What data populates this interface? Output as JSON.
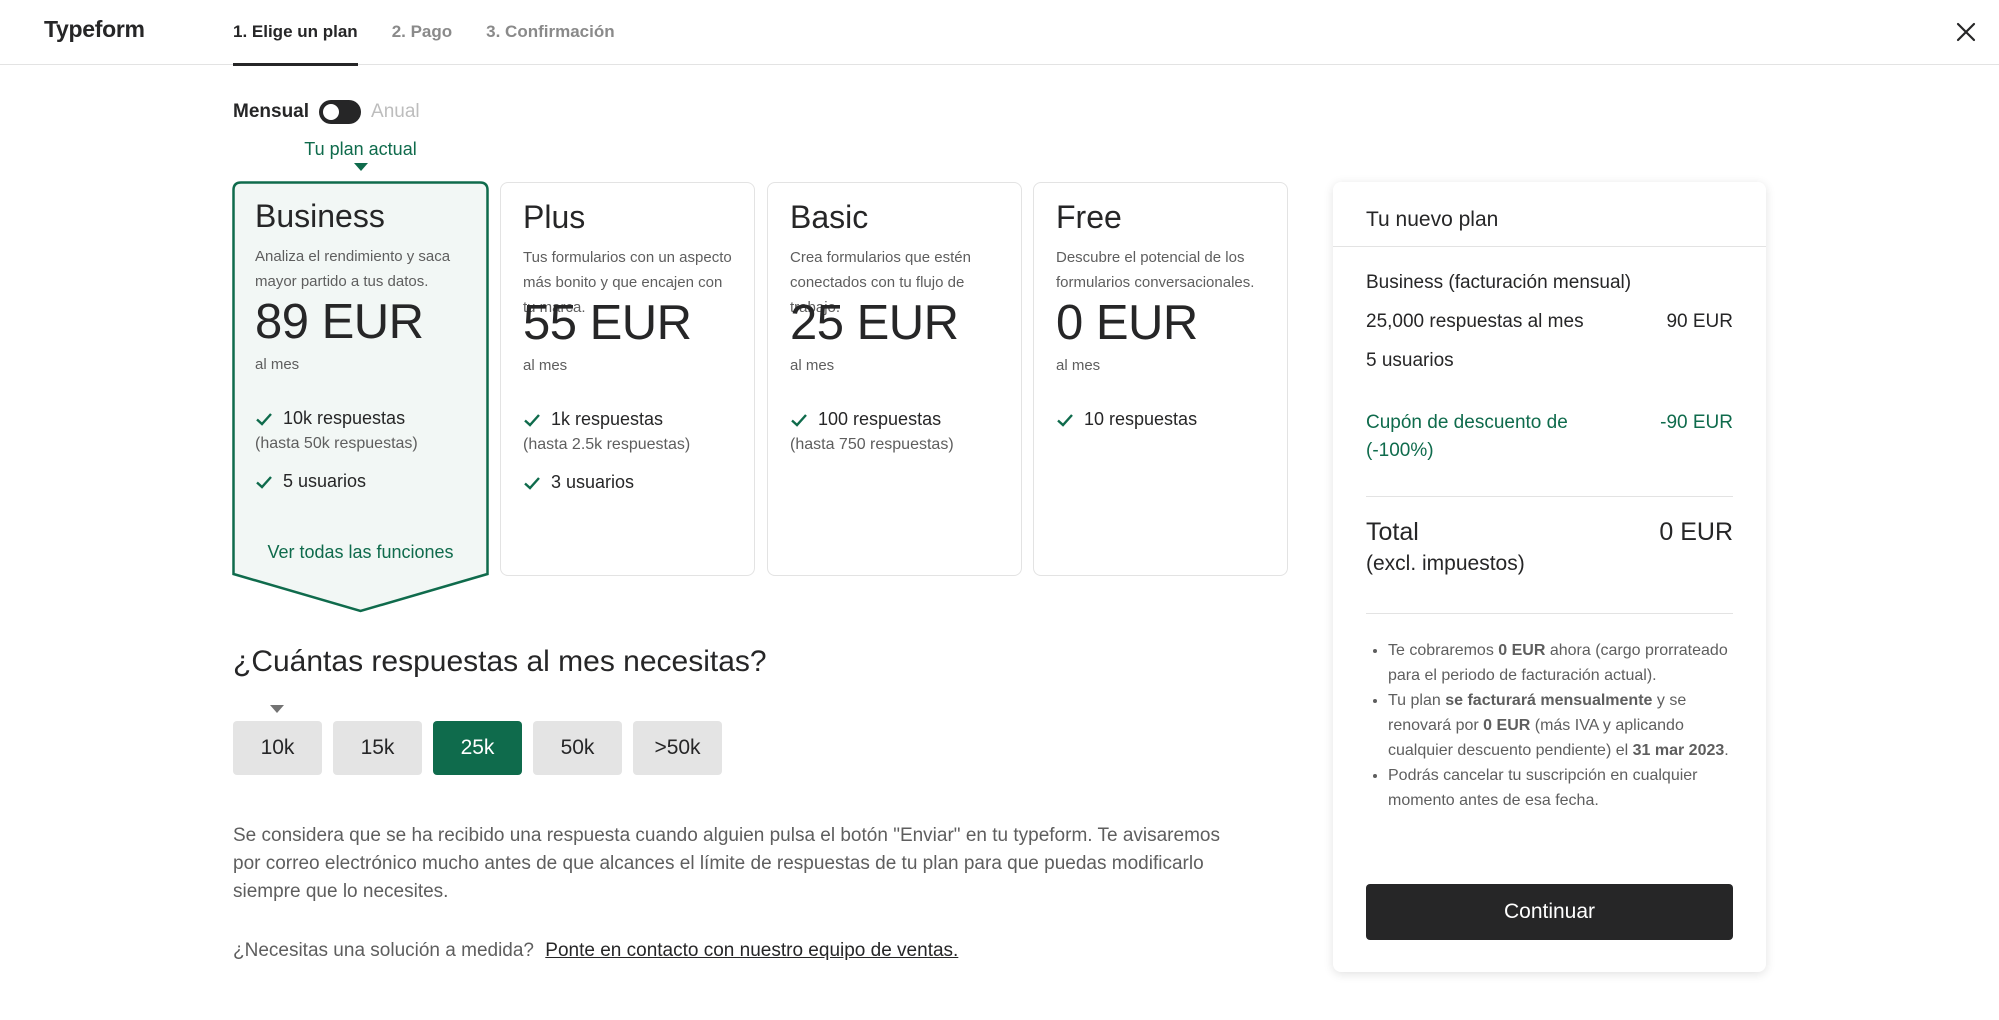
{
  "header": {
    "logo": "Typeform",
    "steps": [
      {
        "label": "1. Elige un plan"
      },
      {
        "label": "2. Pago"
      },
      {
        "label": "3. Confirmación"
      }
    ]
  },
  "billing": {
    "monthly_label": "Mensual",
    "yearly_label": "Anual",
    "current_plan_label": "Tu plan actual"
  },
  "plans": [
    {
      "name": "Business",
      "description": "Analiza el rendimiento y saca mayor partido a tus datos.",
      "price": "89 EUR",
      "period": "al mes",
      "features": [
        {
          "text": "10k respuestas",
          "sub": "(hasta 50k respuestas)"
        },
        {
          "text": "5 usuarios"
        }
      ],
      "see_all": "Ver todas las funciones"
    },
    {
      "name": "Plus",
      "description": "Tus formularios con un aspecto más bonito y que encajen con tu marca.",
      "price": "55 EUR",
      "period": "al mes",
      "features": [
        {
          "text": "1k respuestas",
          "sub": "(hasta 2.5k respuestas)"
        },
        {
          "text": "3 usuarios"
        }
      ]
    },
    {
      "name": "Basic",
      "description": "Crea formularios que estén conectados con tu flujo de trabajo.",
      "price": "25 EUR",
      "period": "al mes",
      "features": [
        {
          "text": "100 respuestas",
          "sub": "(hasta 750 respuestas)"
        }
      ]
    },
    {
      "name": "Free",
      "description": "Descubre el potencial de los formularios conversacionales.",
      "price": "0 EUR",
      "period": "al mes",
      "features": [
        {
          "text": "10 respuestas"
        }
      ]
    }
  ],
  "responses": {
    "question": "¿Cuántas respuestas al mes necesitas?",
    "tiers": [
      "10k",
      "15k",
      "25k",
      "50k",
      ">50k"
    ],
    "selected": "25k",
    "info": "Se considera que se ha recibido una respuesta cuando alguien pulsa el botón \"Enviar\" en tu typeform. Te avisaremos por correo electrónico mucho antes de que alcances el límite de respuestas de tu plan para que puedas modificarlo siempre que lo necesites.",
    "sales_question": "¿Necesitas una solución a medida?",
    "sales_link": "Ponte en contacto con nuestro equipo de ventas."
  },
  "summary": {
    "title": "Tu nuevo plan",
    "plan_line": "Business (facturación mensual)",
    "responses_line": "25,000 respuestas al mes",
    "responses_price": "90 EUR",
    "users_line": "5 usuarios",
    "coupon_label": "Cupón de descuento de (-100%)",
    "coupon_value": "-90 EUR",
    "total_label": "Total",
    "total_sub": "(excl. impuestos)",
    "total_value": "0 EUR",
    "notes": {
      "n1_a": "Te cobraremos ",
      "n1_b": "0 EUR",
      "n1_c": " ahora (cargo prorrateado para el periodo de facturación actual).",
      "n2_a": "Tu plan ",
      "n2_b": "se facturará mensualmente",
      "n2_c": " y se renovará por ",
      "n2_d": "0 EUR",
      "n2_e": " (más IVA y aplicando cualquier descuento pendiente) el ",
      "n2_f": "31 mar 2023",
      "n2_g": ".",
      "n3": "Podrás cancelar tu suscripción en cualquier momento antes de esa fecha."
    },
    "continue_label": "Continuar"
  },
  "colors": {
    "brand_green": "#0f6b4c",
    "dark": "#262627",
    "card_selected_bg": "#f2f7f5"
  },
  "icons": {
    "close": "close-icon",
    "check": "check-icon"
  }
}
